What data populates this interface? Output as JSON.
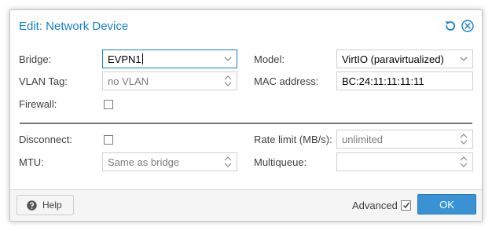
{
  "dialog": {
    "title": "Edit: Network Device",
    "tools": [
      "reset-icon",
      "close-icon"
    ]
  },
  "form": {
    "bridge": {
      "label": "Bridge:",
      "value": "EVPN1"
    },
    "vlan_tag": {
      "label": "VLAN Tag:",
      "placeholder": "no VLAN"
    },
    "firewall": {
      "label": "Firewall:",
      "checked": false
    },
    "model": {
      "label": "Model:",
      "value": "VirtIO (paravirtualized)"
    },
    "mac_address": {
      "label": "MAC address:",
      "value": "BC:24:11:11:11:11"
    },
    "disconnect": {
      "label": "Disconnect:",
      "checked": false
    },
    "mtu": {
      "label": "MTU:",
      "placeholder": "Same as bridge"
    },
    "rate_limit": {
      "label": "Rate limit (MB/s):",
      "placeholder": "unlimited"
    },
    "multiqueue": {
      "label": "Multiqueue:",
      "value": ""
    }
  },
  "footer": {
    "help_label": "Help",
    "advanced_label": "Advanced",
    "advanced_checked": true,
    "ok_label": "OK"
  },
  "colors": {
    "accent": "#157fcc",
    "ok_button": "#3892d4"
  }
}
